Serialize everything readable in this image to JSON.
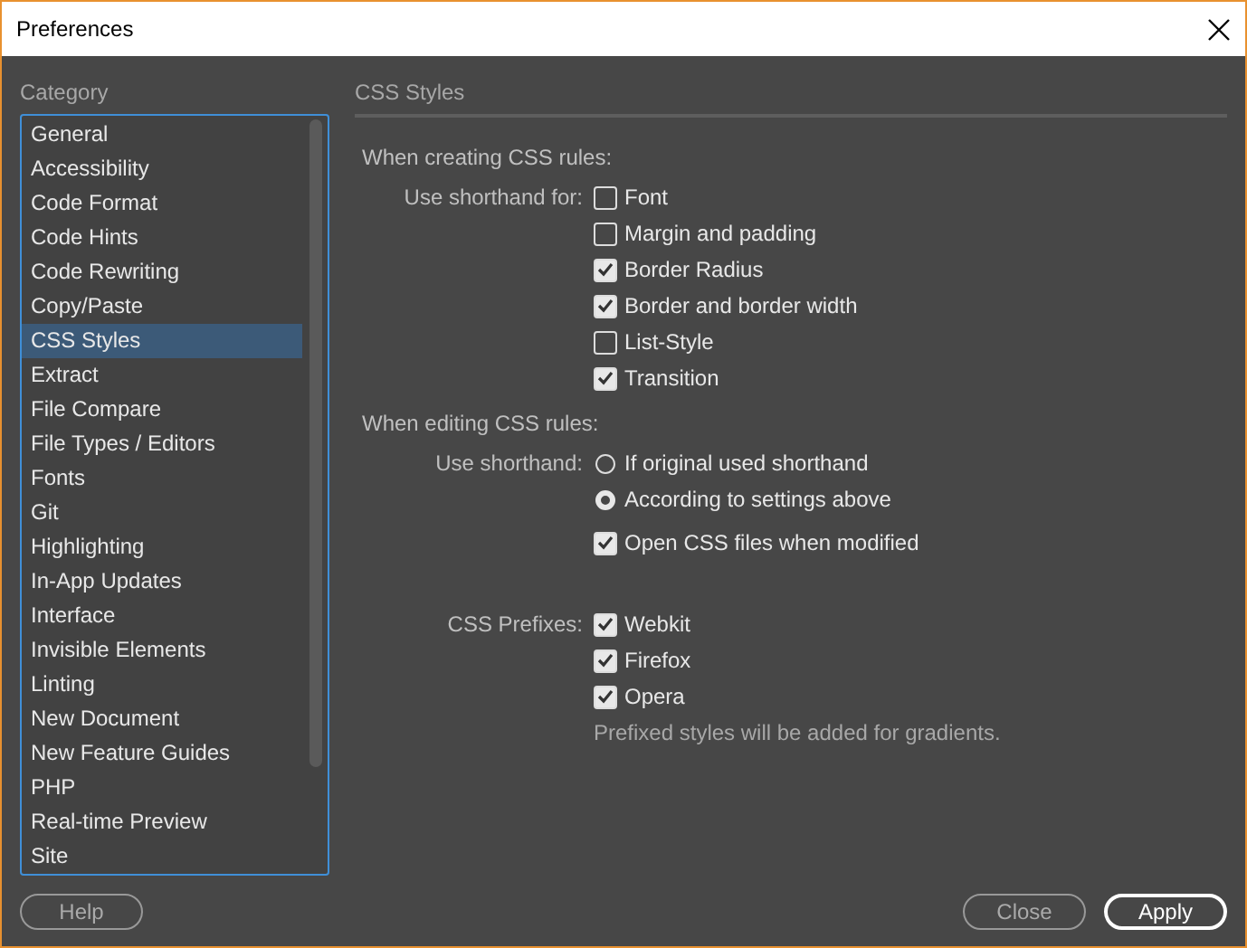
{
  "window": {
    "title": "Preferences"
  },
  "sidebar": {
    "heading": "Category",
    "items": [
      {
        "label": "General",
        "selected": false
      },
      {
        "label": "Accessibility",
        "selected": false
      },
      {
        "label": "Code Format",
        "selected": false
      },
      {
        "label": "Code Hints",
        "selected": false
      },
      {
        "label": "Code Rewriting",
        "selected": false
      },
      {
        "label": "Copy/Paste",
        "selected": false
      },
      {
        "label": "CSS Styles",
        "selected": true
      },
      {
        "label": "Extract",
        "selected": false
      },
      {
        "label": "File Compare",
        "selected": false
      },
      {
        "label": "File Types / Editors",
        "selected": false
      },
      {
        "label": "Fonts",
        "selected": false
      },
      {
        "label": "Git",
        "selected": false
      },
      {
        "label": "Highlighting",
        "selected": false
      },
      {
        "label": "In-App Updates",
        "selected": false
      },
      {
        "label": "Interface",
        "selected": false
      },
      {
        "label": "Invisible Elements",
        "selected": false
      },
      {
        "label": "Linting",
        "selected": false
      },
      {
        "label": "New Document",
        "selected": false
      },
      {
        "label": "New Feature Guides",
        "selected": false
      },
      {
        "label": "PHP",
        "selected": false
      },
      {
        "label": "Real-time Preview",
        "selected": false
      },
      {
        "label": "Site",
        "selected": false
      }
    ]
  },
  "panel": {
    "title": "CSS Styles",
    "sections": [
      {
        "kind": "heading",
        "text": "When creating CSS rules:"
      },
      {
        "kind": "group",
        "label": "Use shorthand for:",
        "options": [
          {
            "kind": "checkbox",
            "label": "Font",
            "checked": false
          },
          {
            "kind": "checkbox",
            "label": "Margin and padding",
            "checked": false
          },
          {
            "kind": "checkbox",
            "label": "Border Radius",
            "checked": true
          },
          {
            "kind": "checkbox",
            "label": "Border and border width",
            "checked": true
          },
          {
            "kind": "checkbox",
            "label": "List-Style",
            "checked": false
          },
          {
            "kind": "checkbox",
            "label": "Transition",
            "checked": true
          }
        ]
      },
      {
        "kind": "heading",
        "text": "When editing CSS rules:"
      },
      {
        "kind": "group",
        "label": "Use shorthand:",
        "options": [
          {
            "kind": "radio",
            "label": "If original used shorthand",
            "selected": false
          },
          {
            "kind": "radio",
            "label": "According to settings above",
            "selected": true
          },
          {
            "kind": "checkbox",
            "label": "Open CSS files when modified",
            "checked": true
          }
        ]
      },
      {
        "kind": "group",
        "label": "CSS Prefixes:",
        "options": [
          {
            "kind": "checkbox",
            "label": "Webkit",
            "checked": true
          },
          {
            "kind": "checkbox",
            "label": "Firefox",
            "checked": true
          },
          {
            "kind": "checkbox",
            "label": "Opera",
            "checked": true
          }
        ],
        "note": "Prefixed styles will be added for gradients."
      }
    ]
  },
  "buttons": [
    {
      "label": "Help",
      "default": false
    },
    {
      "label": "Close",
      "default": false
    },
    {
      "label": "Apply",
      "default": true
    }
  ]
}
